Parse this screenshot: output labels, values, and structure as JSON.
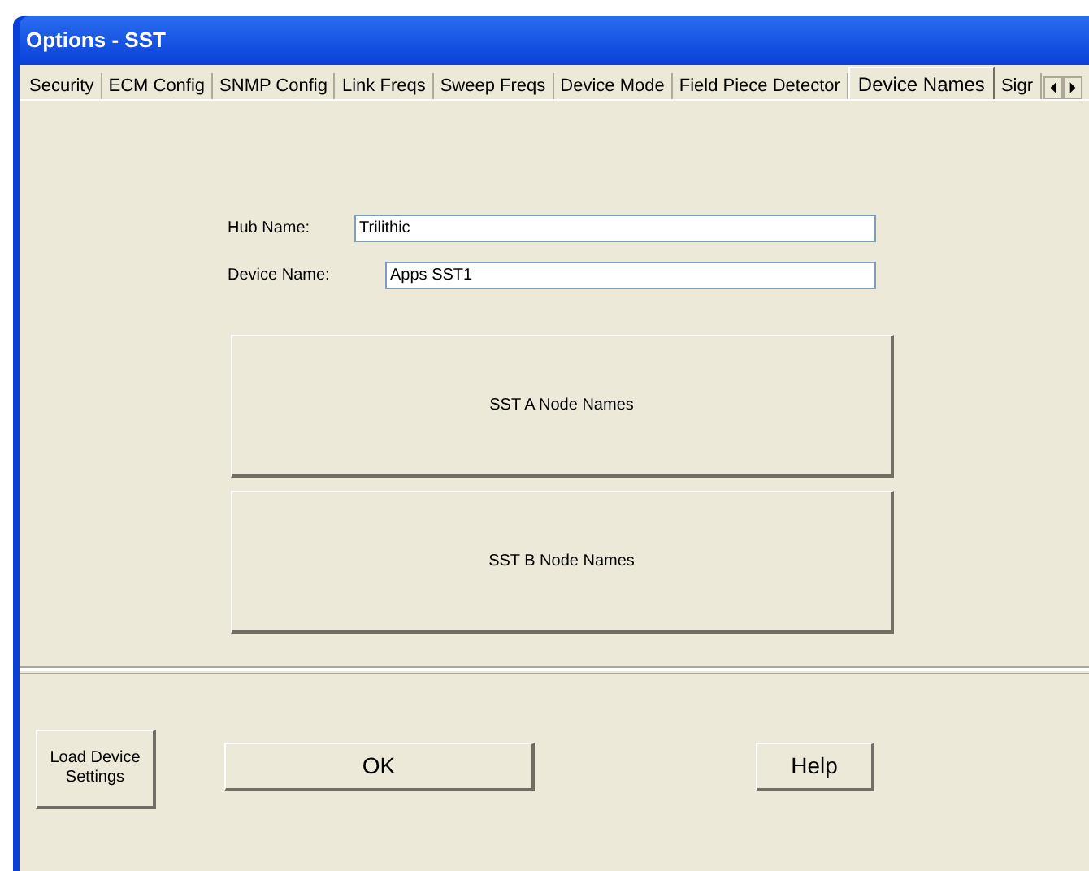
{
  "window": {
    "title": "Options - SST"
  },
  "tabs": [
    {
      "label": "Security",
      "selected": false
    },
    {
      "label": "ECM Config",
      "selected": false
    },
    {
      "label": "SNMP Config",
      "selected": false
    },
    {
      "label": "Link Freqs",
      "selected": false
    },
    {
      "label": "Sweep Freqs",
      "selected": false
    },
    {
      "label": "Device Mode",
      "selected": false
    },
    {
      "label": "Field Piece Detector",
      "selected": false
    },
    {
      "label": "Device Names",
      "selected": true
    },
    {
      "label": "Sigr",
      "selected": false
    }
  ],
  "fields": [
    {
      "label": "Hub Name:",
      "value": "Trilithic"
    },
    {
      "label": "Device Name:",
      "value": "Apps SST1"
    }
  ],
  "node_buttons": [
    "SST A Node Names",
    "SST B Node Names"
  ],
  "footer_buttons": [
    {
      "kind": "small",
      "label": "Load Device Settings"
    },
    {
      "kind": "wide",
      "label": "OK"
    },
    {
      "kind": "medium",
      "label": "Help"
    }
  ]
}
